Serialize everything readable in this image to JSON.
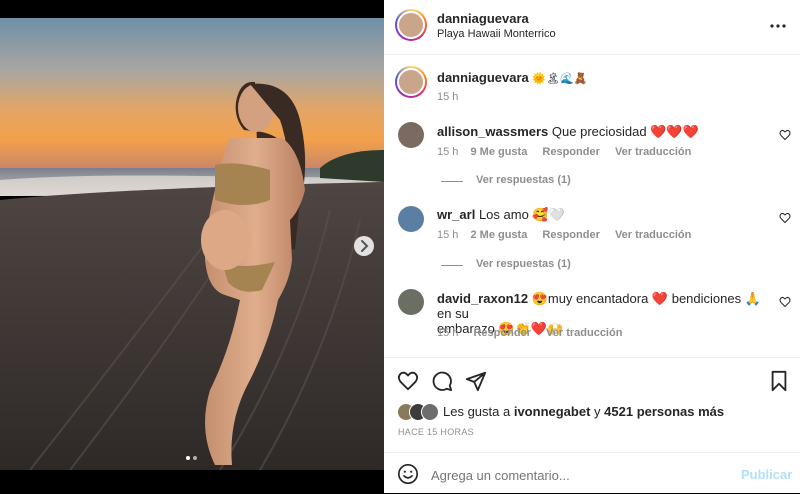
{
  "post": {
    "author": "danniaguevara",
    "location": "Playa Hawaii Monterrico",
    "caption_author": "danniaguevara",
    "caption_text": "🌞🏝🌊🧸",
    "caption_time": "15 h",
    "more_icon": "more-horizontal-icon",
    "carousel_next_icon": "chevron-right-icon",
    "carousel_dots": 2,
    "carousel_active": 0
  },
  "comments": [
    {
      "user": "allison_wassmers",
      "text": "Que preciosidad ❤️❤️❤️",
      "time": "15 h",
      "likes": "9 Me gusta",
      "reply": "Responder",
      "translate": "Ver traducción",
      "view_replies": "Ver respuestas (1)"
    },
    {
      "user": "wr_arl",
      "text": "Los amo 🥰🤍",
      "time": "15 h",
      "likes": "2 Me gusta",
      "reply": "Responder",
      "translate": "Ver traducción",
      "view_replies": "Ver respuestas (1)"
    },
    {
      "user": "david_raxon12",
      "text_line1": "😍muy encantadora ❤️ bendiciones 🙏 en su",
      "text_line2": "embarazo 😍👏❤️🙌",
      "time": "15 h",
      "reply": "Responder",
      "translate": "Ver traducción"
    }
  ],
  "likes": {
    "prefix": "Les gusta a",
    "user": "ivonnegabet",
    "conj": "y",
    "others": "4521 personas más",
    "timestamp": "HACE 15 HORAS"
  },
  "composer": {
    "placeholder": "Agrega un comentario...",
    "publish": "Publicar",
    "emoji_icon": "smiley-icon"
  },
  "colors": {
    "accent": "#0095f6",
    "accent_disabled": "#b2dffc",
    "text": "#262626",
    "secondary": "#8e8e8e"
  }
}
